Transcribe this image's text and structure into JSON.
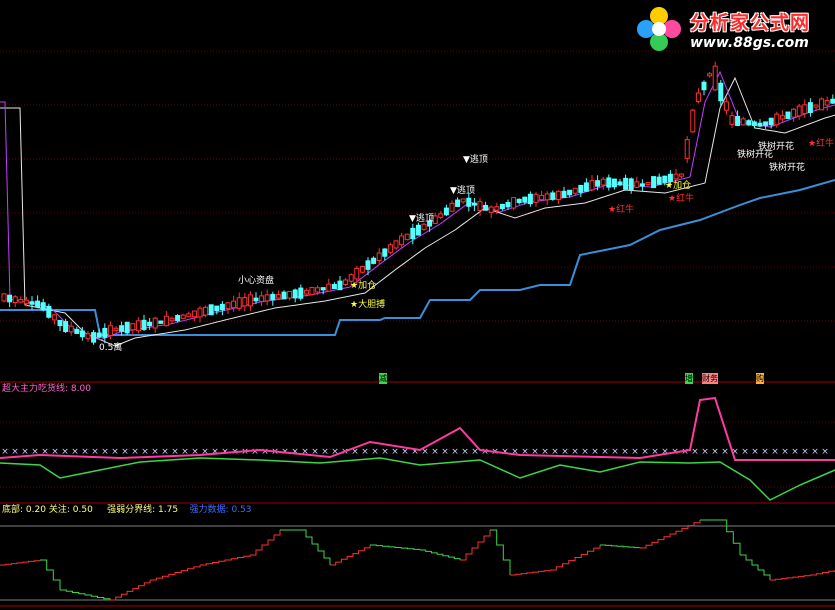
{
  "logo": {
    "title": "分析家公式网",
    "url": "www.88gs.com"
  },
  "main_panel": {
    "signals": {
      "low_point": "0.5寓",
      "caution": "小心资盘",
      "bold_buy": "★大胆搏",
      "add_pos_1": "★加仓",
      "add_pos_2": "★加仓",
      "escape_1": "▼逃顶",
      "escape_2": "▼逃顶",
      "escape_3": "▼逃顶",
      "red_bull_1": "★红牛",
      "red_bull_2": "★红牛",
      "red_bull_3": "★红牛",
      "tree_bloom_1": "铁树开花",
      "tree_bloom_2": "铁树开花",
      "tree_bloom_3": "铁树开花"
    }
  },
  "divider_tags": {
    "tag1": "减",
    "tag2": "增",
    "tag3": "财务",
    "tag4": "购"
  },
  "indicator1": {
    "title": "超大主力吃货线:",
    "value": "8.00",
    "colors": {
      "pink": "#ff3aa0",
      "green": "#3cd64a",
      "markers": "#d0d0ff"
    }
  },
  "indicator2": {
    "bottom_label": "底部:",
    "bottom_value": "0.20",
    "focus_label": "关注:",
    "focus_value": "0.50",
    "divider_label": "强弱分界线:",
    "divider_value": "1.75",
    "strength_label": "强力数据:",
    "strength_value": "0.53"
  },
  "colors": {
    "up": "#ff3030",
    "down": "#54ffff",
    "ma_white": "#e6e6e6",
    "ma_purple": "#c040ff",
    "stop_line": "#3a8fd8",
    "grid": "#6a0000"
  }
}
